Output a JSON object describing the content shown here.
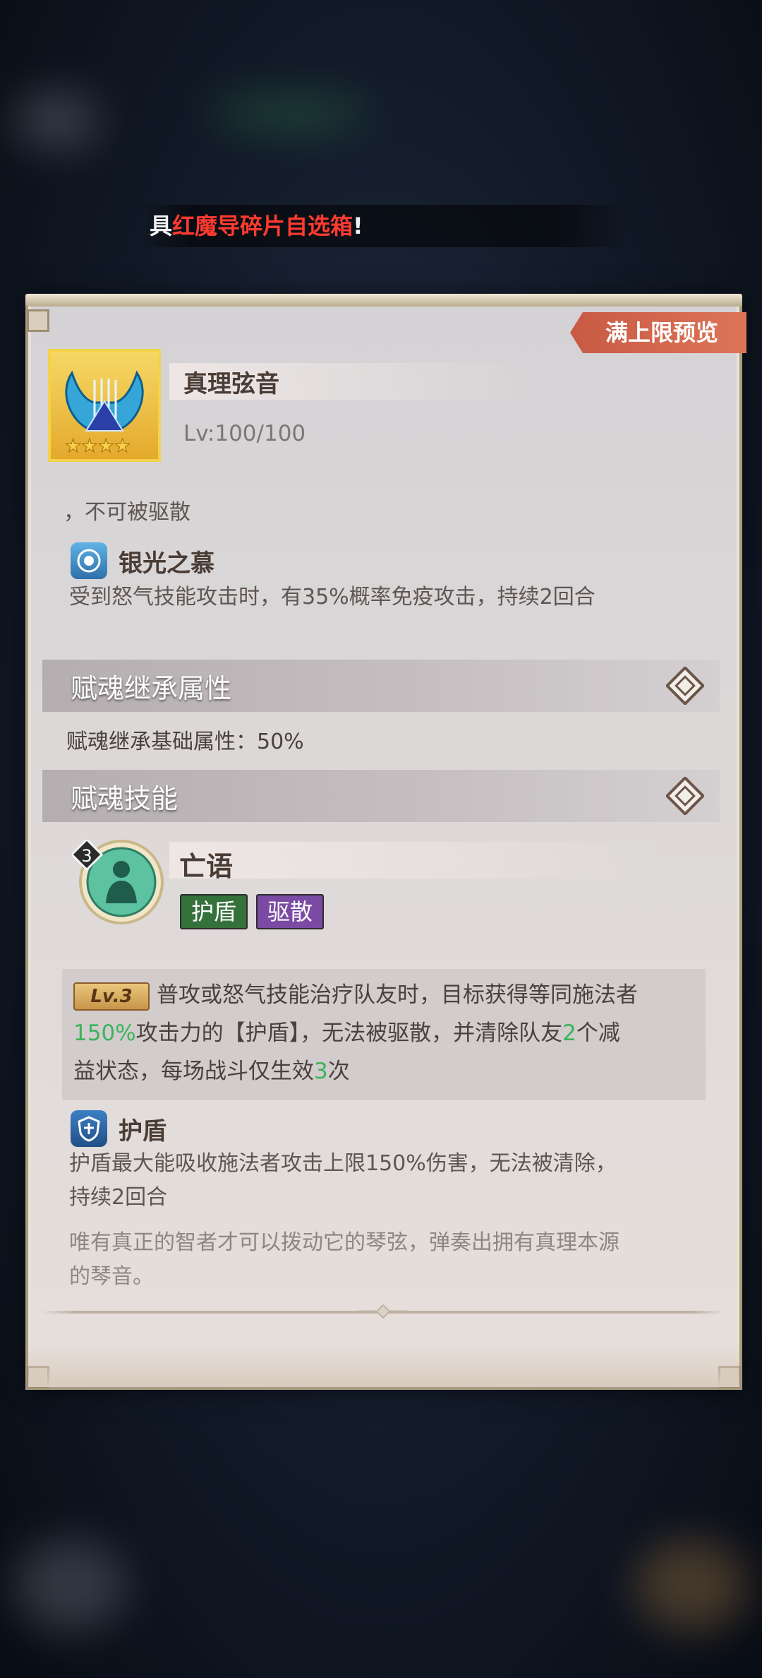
{
  "marquee": {
    "prefix": "具",
    "highlight": "红魔导碎片自选箱",
    "suffix": "!"
  },
  "panel": {
    "preview_label": "满上限预览",
    "item": {
      "name": "真理弦音",
      "level": "Lv:100/100",
      "stars": 4
    },
    "partial_line": "，不可被驱散",
    "silver_skill": {
      "name": "银光之慕",
      "desc": "受到怒气技能攻击时，有35%概率免疫攻击，持续2回合"
    },
    "section_inherit": {
      "title": "赋魂继承属性",
      "stat_text": "赋魂继承基础属性：50%"
    },
    "section_skill": {
      "title": "赋魂技能",
      "skill_name": "亡语",
      "skill_level_badge": "3",
      "tags": [
        "护盾",
        "驱散"
      ],
      "effect": {
        "lv_label": "Lv.3",
        "line1": "普攻或怒气技能治疗队友时，目标获得等同施法者",
        "pct": "150%",
        "line2_rest": "攻击力的【护盾】，无法被驱散，并清除队友",
        "count": "2",
        "line2_end": "个减",
        "line3_start": "益状态，每场战斗仅生效",
        "times": "3",
        "line3_end": "次"
      }
    },
    "shield_skill": {
      "name": "护盾",
      "desc_line1": "护盾最大能吸收施法者攻击上限150%伤害，无法被清除，",
      "desc_line2": "持续2回合"
    },
    "flavor": {
      "line1": "唯有真正的智者才可以拨动它的琴弦，弹奏出拥有真理本源",
      "line2": "的琴音。"
    }
  },
  "colors": {
    "accent_red": "#ff3a2f",
    "highlight_green": "#3bb45a",
    "tag_shield": "#35713b",
    "tag_dispel": "#7b4aa4",
    "preview_tag": "#d0634b"
  }
}
